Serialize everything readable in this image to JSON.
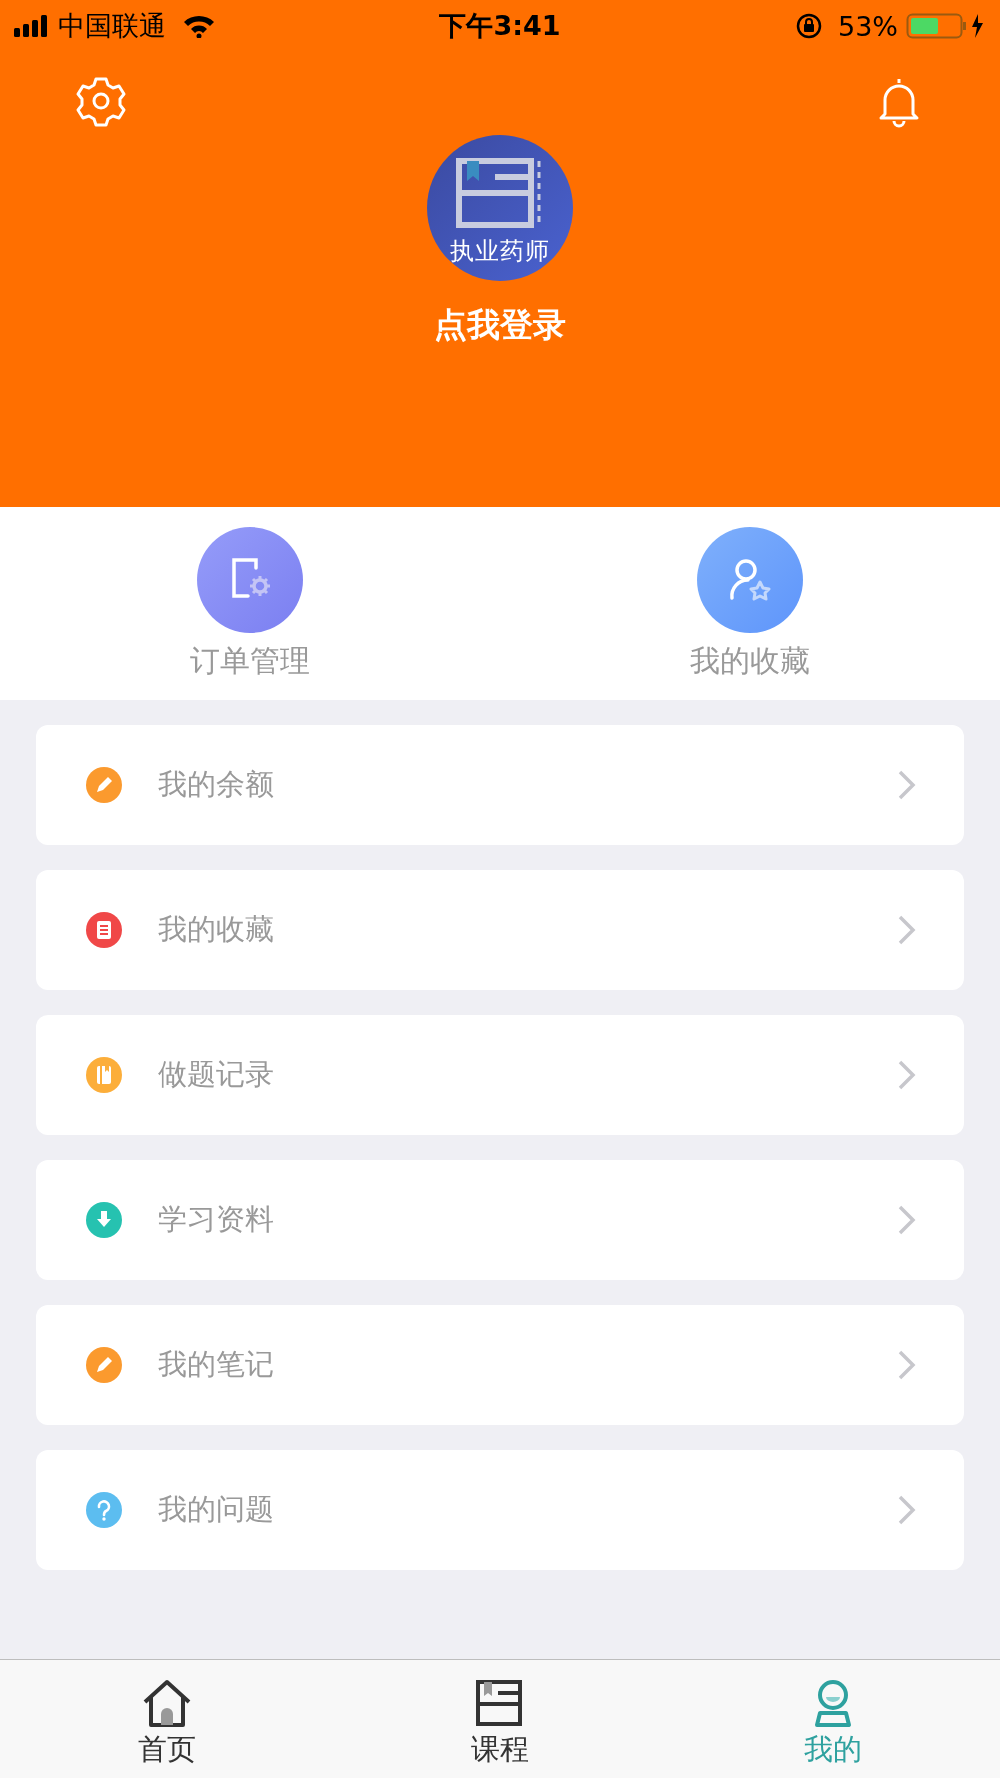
{
  "status_bar": {
    "carrier": "中国联通",
    "time": "下午3:41",
    "battery": "53%"
  },
  "header": {
    "avatar_caption": "执业药师",
    "login": "点我登录"
  },
  "shortcuts": [
    {
      "kind": "order",
      "label": "订单管理"
    },
    {
      "kind": "favorite",
      "label": "我的收藏"
    }
  ],
  "menu": [
    {
      "kind": "pencil",
      "label": "我的余额",
      "color": "#fb9a2e"
    },
    {
      "kind": "list",
      "label": "我的收藏",
      "color": "#f04848"
    },
    {
      "kind": "book",
      "label": "做题记录",
      "color": "#fcae3a"
    },
    {
      "kind": "download",
      "label": "学习资料",
      "color": "#26c2b0"
    },
    {
      "kind": "pencil",
      "label": "我的笔记",
      "color": "#fb9a2e"
    },
    {
      "kind": "question",
      "label": "我的问题",
      "color": "#5cbdf0"
    }
  ],
  "tabs": [
    {
      "kind": "home",
      "label": "首页",
      "selected": false
    },
    {
      "kind": "course",
      "label": "课程",
      "selected": false
    },
    {
      "kind": "me",
      "label": "我的",
      "selected": true
    }
  ]
}
